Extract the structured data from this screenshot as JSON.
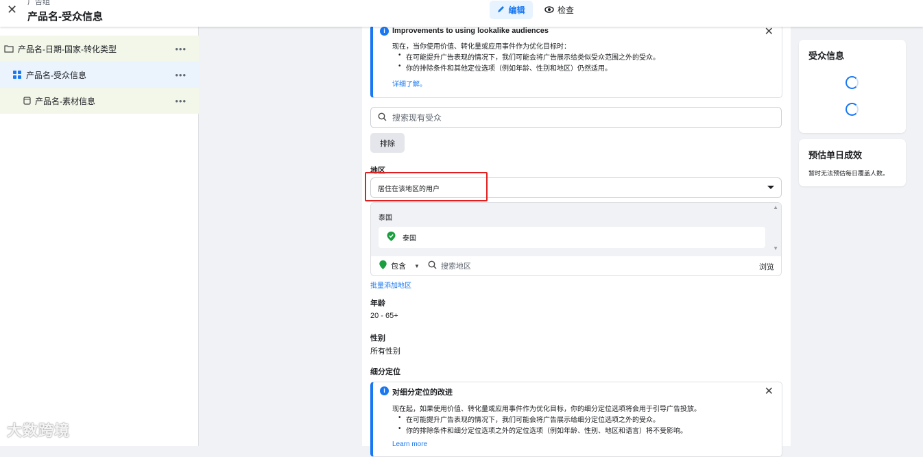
{
  "topbar": {
    "breadcrumb_small": "广告组",
    "title": "产品名-受众信息",
    "mode_edit": "编辑",
    "mode_review": "检查"
  },
  "sidebar": {
    "items": [
      {
        "label": "产品名-日期-国家-转化类型",
        "menu": "•••"
      },
      {
        "label": "产品名-受众信息",
        "menu": "•••"
      },
      {
        "label": "产品名-素材信息",
        "menu": "•••"
      }
    ]
  },
  "notice1": {
    "title": "Improvements to using lookalike audiences",
    "line": "现在，当你使用价值、转化量或应用事件作为优化目标时：",
    "bullets": [
      "在可能提升广告表现的情况下，我们可能会将广告展示给类似受众范围之外的受众。",
      "你的排除条件和其他定位选项（例如年龄、性别和地区）仍然适用。"
    ],
    "link": "详细了解。"
  },
  "search": {
    "placeholder": "搜索现有受众"
  },
  "exclude_label": "排除",
  "location": {
    "label": "地区",
    "select_value": "居住在该地区的用户",
    "country_header": "泰国",
    "country_item": "泰国",
    "include_label": "包含",
    "search_placeholder": "搜索地区",
    "browse": "浏览",
    "bulk_add": "批量添加地区"
  },
  "age": {
    "label": "年龄",
    "value": "20 - 65+"
  },
  "gender": {
    "label": "性别",
    "value": "所有性别"
  },
  "detailed": {
    "label": "细分定位"
  },
  "notice2": {
    "title": "对细分定位的改进",
    "line": "现在起，如果使用价值、转化量或应用事件作为优化目标，你的细分定位选项将会用于引导广告投放。",
    "bullets": [
      "在可能提升广告表现的情况下，我们可能会将广告展示给细分定位选项之外的受众。",
      "你的排除条件和细分定位选项之外的定位选项（例如年龄、性别、地区和语言）将不受影响。"
    ],
    "link": "Learn more"
  },
  "right": {
    "audience_title": "受众信息",
    "estimate_title": "预估单日成效",
    "estimate_note": "暂时无法预估每日覆盖人数。"
  },
  "watermark": "大数跨境",
  "colors": {
    "accent": "#1877f2",
    "highlight_box": "#e02020",
    "include_green": "#1a9e3f"
  }
}
